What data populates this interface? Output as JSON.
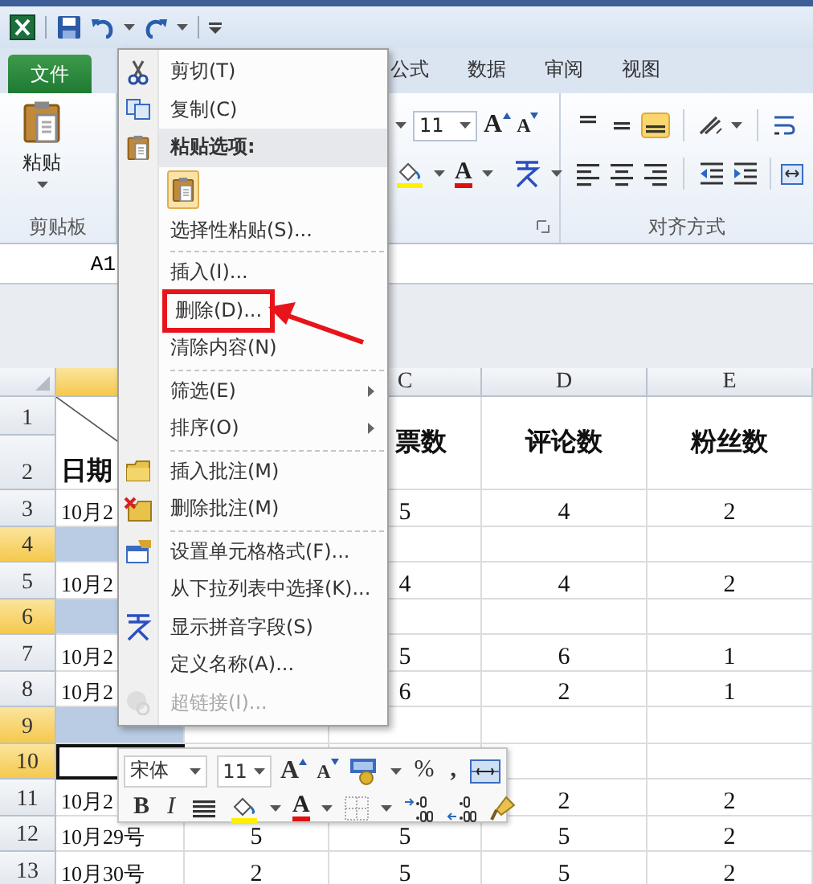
{
  "tabs": [
    {
      "label": "文件",
      "kind": "file"
    },
    {
      "label": "公式",
      "kind": "tab"
    },
    {
      "label": "数据",
      "kind": "tab"
    },
    {
      "label": "审阅",
      "kind": "tab"
    },
    {
      "label": "视图",
      "kind": "tab"
    }
  ],
  "ribbon": {
    "paste_label": "粘贴",
    "clipboard_group": "剪贴板",
    "font_size": "11",
    "grow_label": "A",
    "shrink_label": "A",
    "font_color_label": "A",
    "alignment_group": "对齐方式"
  },
  "name_box": "A1",
  "sheet": {
    "columns": [
      {
        "selected": true
      },
      {
        "label": "C",
        "selected": false
      },
      {
        "label": "D",
        "selected": false
      },
      {
        "label": "E",
        "selected": false
      }
    ],
    "header_cells": [
      "日期",
      null,
      "票数",
      "评论数",
      "粉丝数"
    ],
    "rows": [
      {
        "number": "1",
        "selected": false,
        "active": false
      },
      {
        "number": "2",
        "selected": false,
        "active": false
      },
      {
        "number": "3",
        "selected": false,
        "active": false,
        "cells": [
          "10月2",
          null,
          "5",
          "4",
          "2"
        ]
      },
      {
        "number": "4",
        "selected": true,
        "active": false
      },
      {
        "number": "5",
        "selected": false,
        "active": false,
        "cells": [
          "10月2",
          null,
          "4",
          "4",
          "2"
        ]
      },
      {
        "number": "6",
        "selected": true,
        "active": false
      },
      {
        "number": "7",
        "selected": false,
        "active": false,
        "cells": [
          "10月2",
          null,
          "5",
          "6",
          "1"
        ]
      },
      {
        "number": "8",
        "selected": false,
        "active": false,
        "cells": [
          "10月2",
          null,
          "6",
          "2",
          "1"
        ]
      },
      {
        "number": "9",
        "selected": true,
        "active": false
      },
      {
        "number": "10",
        "selected": true,
        "active": true
      },
      {
        "number": "11",
        "selected": false,
        "active": false,
        "cells": [
          "10月2",
          null,
          null,
          "2",
          "2"
        ]
      },
      {
        "number": "12",
        "selected": false,
        "active": false,
        "cells": [
          "10月29号",
          "5",
          "5",
          "5",
          "2"
        ]
      },
      {
        "number": "13",
        "selected": false,
        "active": false,
        "cells": [
          "10月30号",
          "2",
          "5",
          "5",
          "2"
        ]
      }
    ]
  },
  "menu": {
    "items": [
      {
        "label": "剪切(T)",
        "kind": "item",
        "submenu": false,
        "disabled": false,
        "boxed": false,
        "separator_before": false
      },
      {
        "label": "复制(C)",
        "kind": "item",
        "submenu": false,
        "disabled": false,
        "boxed": false,
        "separator_before": false
      },
      {
        "label": "粘贴选项:",
        "kind": "header",
        "submenu": false,
        "disabled": false,
        "boxed": false,
        "separator_before": false
      },
      {
        "kind": "paste_options",
        "submenu": false,
        "disabled": false,
        "boxed": false,
        "separator_before": false
      },
      {
        "label": "选择性粘贴(S)...",
        "kind": "item",
        "submenu": false,
        "disabled": false,
        "boxed": false,
        "separator_before": false
      },
      {
        "label": "插入(I)...",
        "kind": "item",
        "submenu": false,
        "disabled": false,
        "boxed": false,
        "separator_before": true
      },
      {
        "label": "删除(D)...",
        "kind": "item",
        "submenu": false,
        "disabled": false,
        "boxed": true,
        "separator_before": false
      },
      {
        "label": "清除内容(N)",
        "kind": "item",
        "submenu": false,
        "disabled": false,
        "boxed": false,
        "separator_before": false
      },
      {
        "label": "筛选(E)",
        "kind": "item",
        "submenu": true,
        "disabled": false,
        "boxed": false,
        "separator_before": true
      },
      {
        "label": "排序(O)",
        "kind": "item",
        "submenu": true,
        "disabled": false,
        "boxed": false,
        "separator_before": false
      },
      {
        "label": "插入批注(M)",
        "kind": "item",
        "submenu": false,
        "disabled": false,
        "boxed": false,
        "separator_before": true
      },
      {
        "label": "删除批注(M)",
        "kind": "item",
        "submenu": false,
        "disabled": false,
        "boxed": false,
        "separator_before": false
      },
      {
        "label": "设置单元格格式(F)...",
        "kind": "item",
        "submenu": false,
        "disabled": false,
        "boxed": false,
        "separator_before": true
      },
      {
        "label": "从下拉列表中选择(K)...",
        "kind": "item",
        "submenu": false,
        "disabled": false,
        "boxed": false,
        "separator_before": false
      },
      {
        "label": "显示拼音字段(S)",
        "kind": "item",
        "submenu": false,
        "disabled": false,
        "boxed": false,
        "separator_before": false
      },
      {
        "label": "定义名称(A)...",
        "kind": "item",
        "submenu": false,
        "disabled": false,
        "boxed": false,
        "separator_before": false
      },
      {
        "label": "超链接(I)...",
        "kind": "item",
        "submenu": false,
        "disabled": true,
        "boxed": false,
        "separator_before": false
      }
    ]
  },
  "mini_toolbar": {
    "font": "宋体",
    "size": "11",
    "grow_label": "A",
    "shrink_label": "A",
    "percent_label": "%",
    "comma_label": ",",
    "bold_label": "B",
    "italic_label": "I",
    "font_color_label": "A"
  }
}
